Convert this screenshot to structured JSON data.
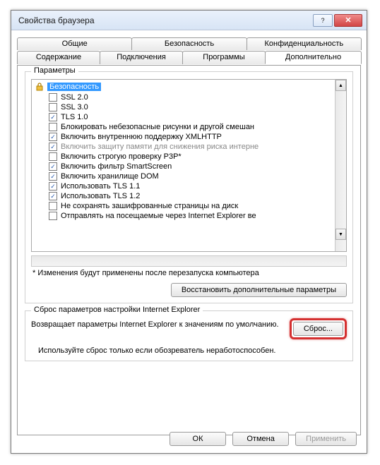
{
  "window": {
    "title": "Свойства браузера"
  },
  "tabs": {
    "row1": [
      "Общие",
      "Безопасность",
      "Конфиденциальность"
    ],
    "row2": [
      "Содержание",
      "Подключения",
      "Программы",
      "Дополнительно"
    ],
    "active": "Дополнительно"
  },
  "settings_group": {
    "title": "Параметры",
    "category": {
      "icon": "lock-icon",
      "label": "Безопасность"
    },
    "items": [
      {
        "checked": false,
        "label": "SSL 2.0",
        "disabled": false
      },
      {
        "checked": false,
        "label": "SSL 3.0",
        "disabled": false
      },
      {
        "checked": true,
        "label": "TLS 1.0",
        "disabled": false
      },
      {
        "checked": false,
        "label": "Блокировать небезопасные рисунки и другой смешан",
        "disabled": false
      },
      {
        "checked": true,
        "label": "Включить внутреннюю поддержку XMLHTTP",
        "disabled": false
      },
      {
        "checked": true,
        "label": "Включить защиту памяти для снижения риска интерне",
        "disabled": true
      },
      {
        "checked": false,
        "label": "Включить строгую проверку P3P*",
        "disabled": false
      },
      {
        "checked": true,
        "label": "Включить фильтр SmartScreen",
        "disabled": false
      },
      {
        "checked": true,
        "label": "Включить хранилище DOM",
        "disabled": false
      },
      {
        "checked": true,
        "label": "Использовать TLS 1.1",
        "disabled": false
      },
      {
        "checked": true,
        "label": "Использовать TLS 1.2",
        "disabled": false
      },
      {
        "checked": false,
        "label": "Не сохранять зашифрованные страницы на диск",
        "disabled": false
      },
      {
        "checked": false,
        "label": "Отправлять на посещаемые через Internet Explorer ве",
        "disabled": false
      }
    ],
    "restart_note": "* Изменения будут применены после перезапуска компьютера",
    "restore_button": "Восстановить дополнительные параметры"
  },
  "reset_group": {
    "title": "Сброс параметров настройки Internet Explorer",
    "description": "Возвращает параметры Internet Explorer к значениям по умолчанию.",
    "button": "Сброс...",
    "note": "Используйте сброс только если обозреватель неработоспособен."
  },
  "footer": {
    "ok": "ОК",
    "cancel": "Отмена",
    "apply": "Применить"
  }
}
